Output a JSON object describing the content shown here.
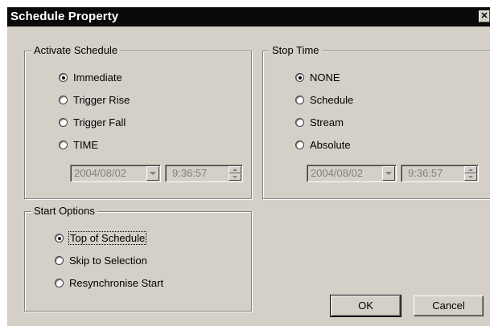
{
  "window": {
    "title": "Schedule Property",
    "close_glyph": "✕"
  },
  "activate": {
    "legend": "Activate Schedule",
    "options": [
      {
        "label": "Immediate",
        "checked": true
      },
      {
        "label": "Trigger Rise",
        "checked": false
      },
      {
        "label": "Trigger Fall",
        "checked": false
      },
      {
        "label": "TIME",
        "checked": false
      }
    ],
    "date": "2004/08/02",
    "time": "9:36:57"
  },
  "stop": {
    "legend": "Stop Time",
    "options": [
      {
        "label": "NONE",
        "checked": true
      },
      {
        "label": "Schedule",
        "checked": false
      },
      {
        "label": "Stream",
        "checked": false
      },
      {
        "label": "Absolute",
        "checked": false
      }
    ],
    "date": "2004/08/02",
    "time": "9:36:57"
  },
  "start": {
    "legend": "Start Options",
    "options": [
      {
        "label": "Top of Schedule",
        "checked": true
      },
      {
        "label": "Skip to Selection",
        "checked": false
      },
      {
        "label": "Resynchronise Start",
        "checked": false
      }
    ]
  },
  "buttons": {
    "ok": "OK",
    "cancel": "Cancel"
  }
}
